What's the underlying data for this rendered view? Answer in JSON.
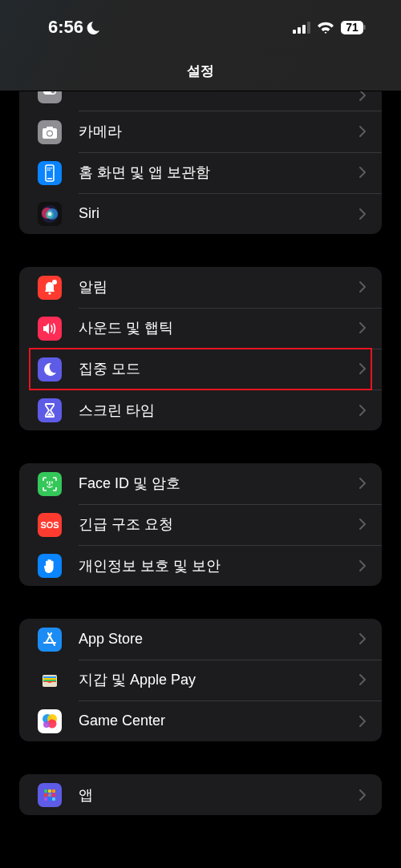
{
  "status_bar": {
    "time": "6:56",
    "focus_moon": true,
    "battery": "71"
  },
  "nav": {
    "title": "설정"
  },
  "groups": [
    {
      "items": [
        {
          "kind": "toggle",
          "highlighted": false
        },
        {
          "kind": "camera",
          "label": "카메라",
          "highlighted": false
        },
        {
          "kind": "homescreen",
          "label": "홈 화면 및 앱 보관함",
          "highlighted": false
        },
        {
          "kind": "siri",
          "label": "Siri",
          "highlighted": false
        }
      ]
    },
    {
      "items": [
        {
          "kind": "bell",
          "label": "알림",
          "highlighted": false
        },
        {
          "kind": "sound",
          "label": "사운드 및 햅틱",
          "highlighted": false
        },
        {
          "kind": "moon",
          "label": "집중 모드",
          "highlighted": true
        },
        {
          "kind": "hourglass",
          "label": "스크린 타임",
          "highlighted": false
        }
      ]
    },
    {
      "items": [
        {
          "kind": "faceid",
          "label": "Face ID 및 암호",
          "highlighted": false
        },
        {
          "kind": "sos",
          "label": "긴급 구조 요청",
          "icon_text": "SOS",
          "highlighted": false
        },
        {
          "kind": "hand",
          "label": "개인정보 보호 및 보안",
          "highlighted": false
        }
      ]
    },
    {
      "items": [
        {
          "kind": "appstore",
          "label": "App Store",
          "highlighted": false
        },
        {
          "kind": "wallet",
          "label": "지갑 및 Apple Pay",
          "highlighted": false
        },
        {
          "kind": "gamecenter",
          "label": "Game Center",
          "highlighted": false
        }
      ]
    },
    {
      "items": [
        {
          "kind": "apps",
          "label": "앱",
          "highlighted": false
        }
      ]
    }
  ]
}
